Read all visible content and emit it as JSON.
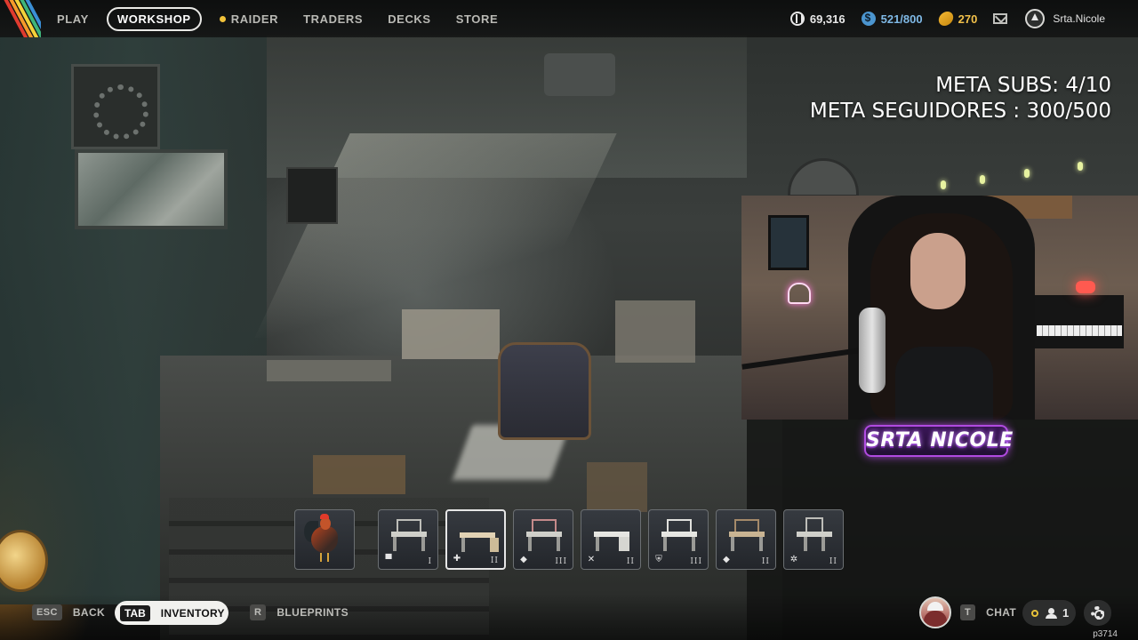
{
  "nav": {
    "items": [
      {
        "label": "PLAY",
        "active": false
      },
      {
        "label": "WORKSHOP",
        "active": true
      },
      {
        "label": "RAIDER",
        "active": false,
        "dot": true
      },
      {
        "label": "TRADERS",
        "active": false
      },
      {
        "label": "DECKS",
        "active": false
      },
      {
        "label": "STORE",
        "active": false
      }
    ],
    "stripe_colors": [
      "#e03b2f",
      "#f59a2a",
      "#f3d23a",
      "#3fb47a",
      "#3a8fd6"
    ]
  },
  "currencies": {
    "coins": "69,316",
    "credits": "521/800",
    "tokens": "270",
    "credits_color": "#4b95cf",
    "tokens_color": "#f2b632"
  },
  "user": {
    "name": "Srta.Nicole"
  },
  "overlay": {
    "meta_subs": "META SUBS: 4/10",
    "meta_seguidores": "META SEGUIDORES : 300/500",
    "brand_label": "SRTA NICOLE",
    "brand_color": "#b04ae0"
  },
  "items": [
    {
      "name": "rooster",
      "icon": "rooster-icon",
      "glyph": "",
      "tier": "",
      "selected": false
    },
    {
      "name": "workbench-1",
      "icon": "workbench-icon",
      "glyph": "▀",
      "tier": "I",
      "selected": false
    },
    {
      "name": "workbench-2",
      "icon": "workbench-icon",
      "glyph": "✚",
      "tier": "II",
      "selected": true
    },
    {
      "name": "workbench-3",
      "icon": "workbench-icon",
      "glyph": "◆",
      "tier": "III",
      "selected": false
    },
    {
      "name": "workbench-4",
      "icon": "workbench-icon",
      "glyph": "✕",
      "tier": "II",
      "selected": false
    },
    {
      "name": "workbench-5",
      "icon": "workbench-icon",
      "glyph": "⛨",
      "tier": "III",
      "selected": false
    },
    {
      "name": "workbench-6",
      "icon": "workbench-icon",
      "glyph": "◆",
      "tier": "II",
      "selected": false
    },
    {
      "name": "workbench-7",
      "icon": "workbench-icon",
      "glyph": "✲",
      "tier": "II",
      "selected": false
    }
  ],
  "bottom": {
    "back_key": "ESC",
    "back_label": "BACK",
    "inventory_key": "TAB",
    "inventory_label": "INVENTORY",
    "blueprints_key": "R",
    "blueprints_label": "BLUEPRINTS",
    "chat_key": "T",
    "chat_label": "CHAT",
    "party_count": "1",
    "build": "p3714"
  }
}
